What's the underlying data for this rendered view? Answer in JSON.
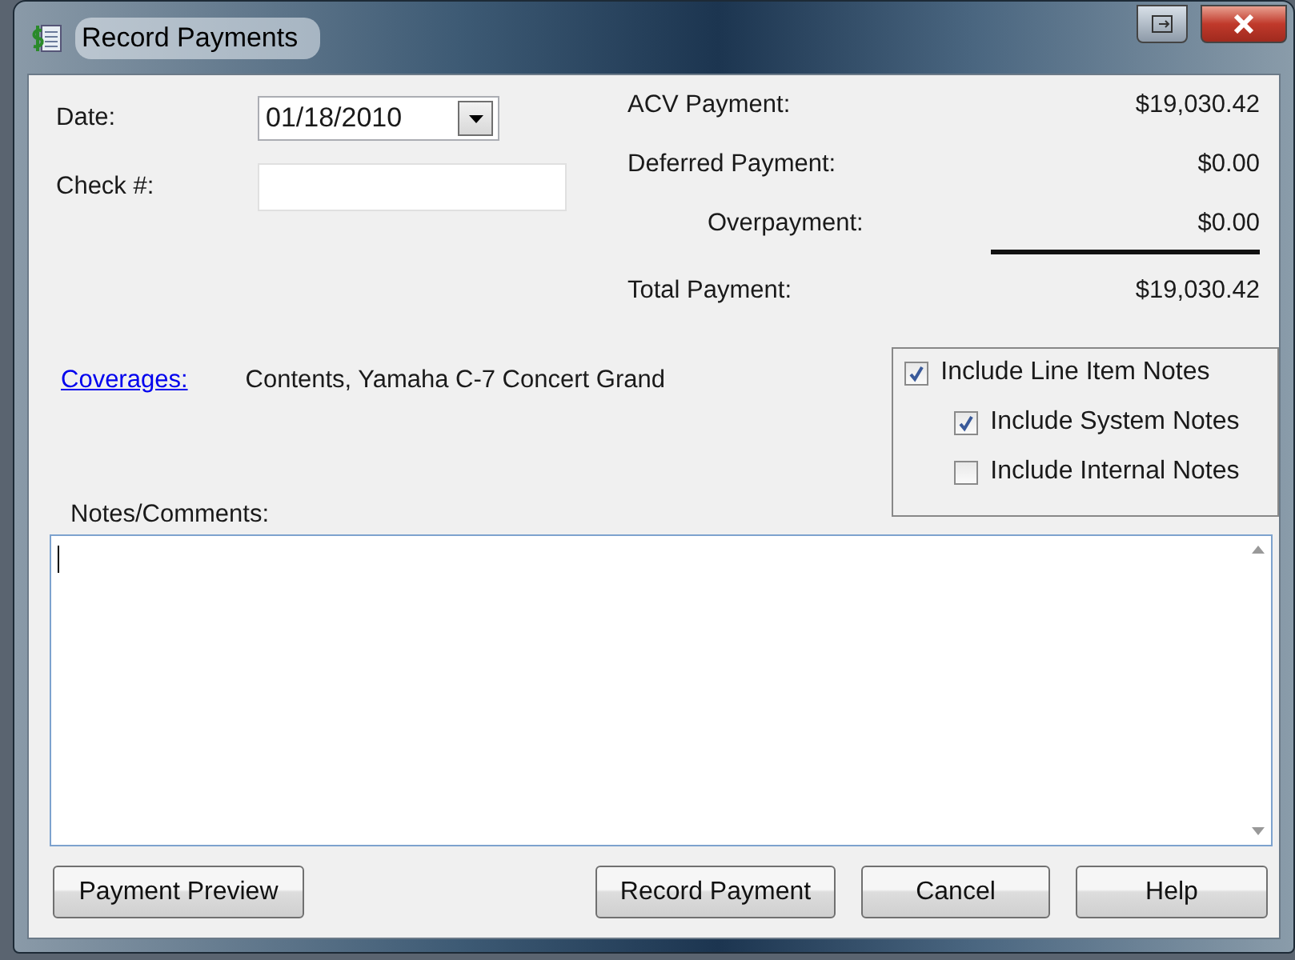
{
  "window": {
    "title": "Record Payments"
  },
  "date": {
    "label": "Date:",
    "value": "01/18/2010"
  },
  "check": {
    "label": "Check #:"
  },
  "payments": [
    {
      "label": "ACV Payment:",
      "amount": "$19,030.42",
      "indented": false
    },
    {
      "label": "Deferred Payment:",
      "amount": "$0.00",
      "indented": false
    },
    {
      "label": "Overpayment:",
      "amount": "$0.00",
      "indented": true
    }
  ],
  "total": {
    "label": "Total Payment:",
    "amount": "$19,030.42"
  },
  "coverages": {
    "link": "Coverages:",
    "text": "Contents, Yamaha C-7 Concert Grand"
  },
  "options": [
    {
      "label": "Include Line Item Notes",
      "checked": true,
      "children": [
        {
          "label": "Include System Notes",
          "checked": true
        },
        {
          "label": "Include Internal Notes",
          "checked": false
        }
      ]
    }
  ],
  "notes": {
    "label": "Notes/Comments:"
  },
  "buttons": [
    {
      "label": "Payment Preview",
      "kind": "left"
    },
    {
      "label": "Record Payment",
      "kind": "right"
    },
    {
      "label": "Cancel",
      "kind": "right"
    },
    {
      "label": "Help",
      "kind": "right"
    }
  ]
}
